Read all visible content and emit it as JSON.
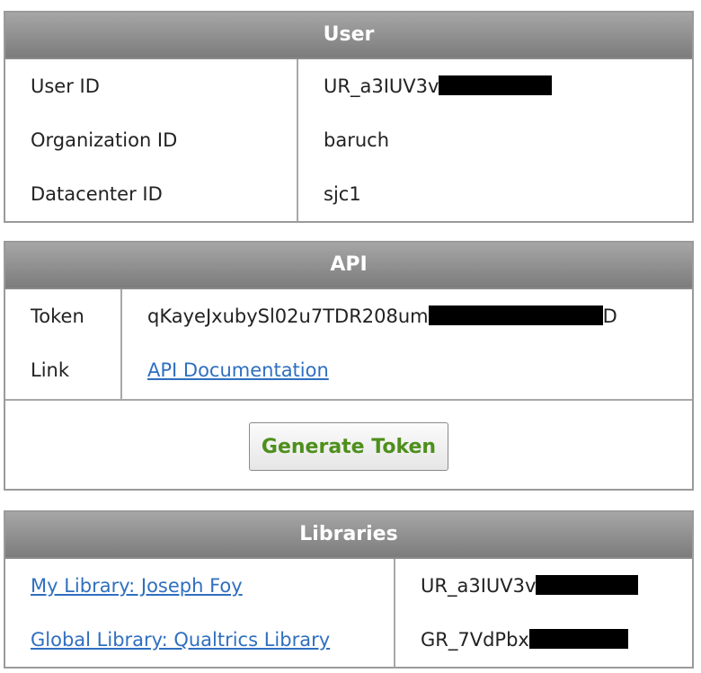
{
  "user": {
    "header": "User",
    "rows": [
      {
        "label": "User ID",
        "value": "UR_a3IUV3v"
      },
      {
        "label": "Organization ID",
        "value": "baruch"
      },
      {
        "label": "Datacenter ID",
        "value": "sjc1"
      }
    ]
  },
  "api": {
    "header": "API",
    "token_label": "Token",
    "token_value_prefix": "qKayeJxubySl02u7TDR208um",
    "token_value_suffix": "D",
    "link_label": "Link",
    "link_text": "API Documentation",
    "generate_button": "Generate Token"
  },
  "libraries": {
    "header": "Libraries",
    "rows": [
      {
        "name": "My Library: Joseph Foy",
        "id": "UR_a3IUV3v"
      },
      {
        "name": "Global Library: Qualtrics Library",
        "id": "GR_7VdPbx"
      }
    ]
  },
  "colors": {
    "header_gradient_top": "#a6a6a6",
    "header_gradient_bottom": "#7c7c7c",
    "link": "#2f6fbf",
    "button_text": "#4e8f1c"
  }
}
